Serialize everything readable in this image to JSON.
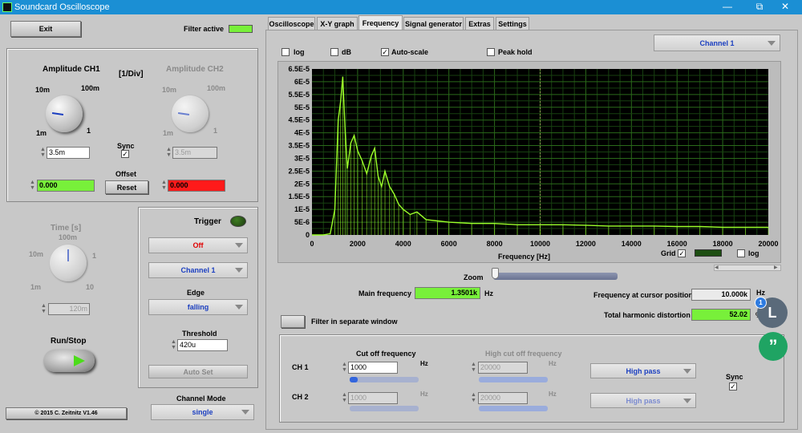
{
  "window": {
    "title": "Soundcard Oscilloscope",
    "minimize": "—",
    "maximize": "⧉",
    "close": "✕"
  },
  "left": {
    "exit_label": "Exit",
    "filter_active_label": "Filter active",
    "amp_ch1_label": "Amplitude CH1",
    "per_div_label": "[1/Div]",
    "amp_ch2_label": "Amplitude CH2",
    "knob_scale": {
      "k10m": "10m",
      "k100m": "100m",
      "k1m": "1m",
      "k1": "1"
    },
    "sync_label": "Sync",
    "ch1_amp_value": "3.5m",
    "ch2_amp_value": "3.5m",
    "offset_label": "Offset",
    "reset_label": "Reset",
    "ch1_offset": "0.000",
    "ch2_offset": "0.000",
    "time_label": "Time [s]",
    "time_scale": {
      "t100m": "100m",
      "t10m": "10m",
      "t1": "1",
      "t1m": "1m",
      "t10": "10"
    },
    "time_value": "120m",
    "run_stop_label": "Run/Stop",
    "copyright": "© 2015  C. Zeitnitz V1.46",
    "channel_mode_label": "Channel Mode",
    "channel_mode_value": "single"
  },
  "trigger": {
    "title": "Trigger",
    "mode": "Off",
    "channel": "Channel 1",
    "edge_label": "Edge",
    "edge_value": "falling",
    "threshold_label": "Threshold",
    "threshold_value": "420u",
    "auto_set_label": "Auto Set"
  },
  "tabs": [
    "Oscilloscope",
    "X-Y graph",
    "Frequency",
    "Signal generator",
    "Extras",
    "Settings"
  ],
  "freq": {
    "channel_select": "Channel 1",
    "log_label": "log",
    "db_label": "dB",
    "autoscale_label": "Auto-scale",
    "peakhold_label": "Peak hold",
    "grid_label": "Grid",
    "log2_label": "log",
    "zoom_label": "Zoom",
    "main_freq_label": "Main frequency",
    "main_freq_value": "1.3501k",
    "main_freq_unit": "Hz",
    "cursor_label": "Frequency at cursor position",
    "cursor_value": "10.000k",
    "cursor_unit": "Hz",
    "thd_label": "Total harmonic distortion",
    "thd_value": "52.02",
    "thd_unit": "%",
    "filter_window_label": "Filter in separate window"
  },
  "filter": {
    "ch1_label": "CH 1",
    "ch2_label": "CH 2",
    "cutoff_label": "Cut off frequency",
    "high_cutoff_label": "High cut off frequency",
    "hz": "Hz",
    "ch1_cutoff": "1000",
    "ch2_cutoff": "1000",
    "ch1_high": "20000",
    "ch2_high": "20000",
    "ch1_type": "High pass",
    "ch2_type": "High pass",
    "sync_label": "Sync"
  },
  "overlay": {
    "avatar_letter": "L",
    "badge": "1",
    "quote": "”"
  },
  "chart_data": {
    "type": "line",
    "xlabel": "Frequency [Hz]",
    "ylabel": "",
    "xlim": [
      0,
      20000
    ],
    "ylim": [
      0,
      6.5e-05
    ],
    "xticks": [
      "0",
      "2000",
      "4000",
      "6000",
      "8000",
      "10000",
      "12000",
      "14000",
      "16000",
      "18000",
      "20000"
    ],
    "yticks": [
      "0",
      "5E-6",
      "1E-5",
      "1.5E-5",
      "2E-5",
      "2.5E-5",
      "3E-5",
      "3.5E-5",
      "4E-5",
      "4.5E-5",
      "5E-5",
      "5.5E-5",
      "6E-5",
      "6.5E-5"
    ],
    "grid": true,
    "cursor_x": 10000,
    "series": [
      {
        "color": "#9cff2a",
        "x": [
          0,
          500,
          800,
          1000,
          1150,
          1250,
          1350,
          1450,
          1550,
          1700,
          1850,
          2000,
          2200,
          2400,
          2600,
          2750,
          2900,
          3050,
          3200,
          3400,
          3600,
          3800,
          4000,
          4300,
          4600,
          5000,
          5500,
          6000,
          7000,
          8000,
          9000,
          10000,
          11000,
          12000,
          13000,
          14000,
          15000,
          16000,
          17000,
          18000,
          19000,
          20000
        ],
        "y": [
          0,
          0,
          5e-07,
          1e-05,
          4.5e-05,
          5.2e-05,
          6.2e-05,
          4.1e-05,
          2.6e-05,
          3.6e-05,
          3.9e-05,
          3.3e-05,
          2.9e-05,
          2.4e-05,
          3.1e-05,
          3.4e-05,
          2.3e-05,
          1.9e-05,
          2.5e-05,
          1.9e-05,
          1.6e-05,
          1.2e-05,
          1e-05,
          8e-06,
          9e-06,
          6e-06,
          5.5e-06,
          5e-06,
          4.5e-06,
          4.5e-06,
          4e-06,
          4e-06,
          4e-06,
          3.8e-06,
          3.5e-06,
          3.5e-06,
          3.5e-06,
          3.3e-06,
          3.3e-06,
          3e-06,
          3e-06,
          3e-06
        ]
      }
    ]
  }
}
